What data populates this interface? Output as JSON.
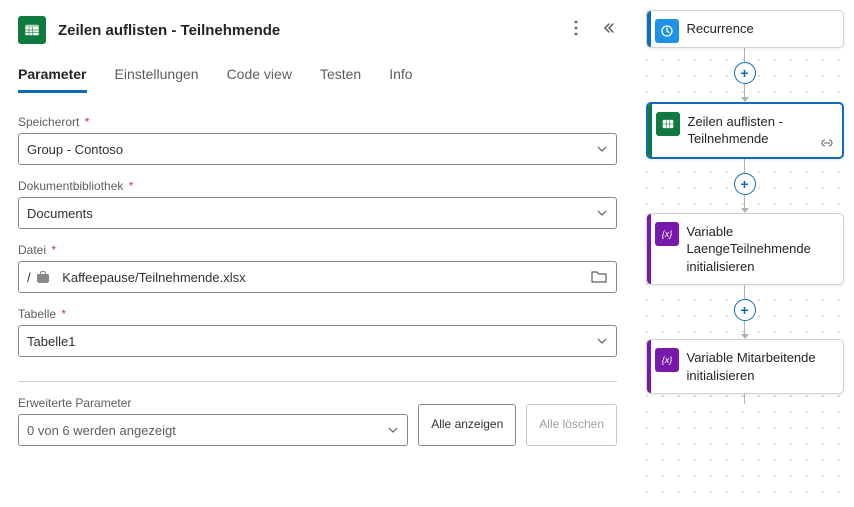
{
  "header": {
    "title": "Zeilen auflisten - Teilnehmende"
  },
  "tabs": [
    {
      "label": "Parameter",
      "active": true
    },
    {
      "label": "Einstellungen"
    },
    {
      "label": "Code view"
    },
    {
      "label": "Testen"
    },
    {
      "label": "Info"
    }
  ],
  "fields": {
    "location": {
      "label": "Speicherort",
      "value": "Group - Contoso"
    },
    "library": {
      "label": "Dokumentbibliothek",
      "value": "Documents"
    },
    "file": {
      "label": "Datei",
      "value": "Kaffeepause/Teilnehmende.xlsx"
    },
    "table": {
      "label": "Tabelle",
      "value": "Tabelle1"
    }
  },
  "advanced": {
    "label": "Erweiterte Parameter",
    "selected": "0 von 6 werden angezeigt",
    "show_all": "Alle anzeigen",
    "clear_all": "Alle löschen"
  },
  "flow": {
    "nodes": [
      {
        "label": "Recurrence"
      },
      {
        "label": "Zeilen auflisten - Teilnehmende"
      },
      {
        "label": "Variable LaengeTeilnehmende initialisieren"
      },
      {
        "label": "Variable Mitarbeitende initialisieren"
      }
    ]
  }
}
